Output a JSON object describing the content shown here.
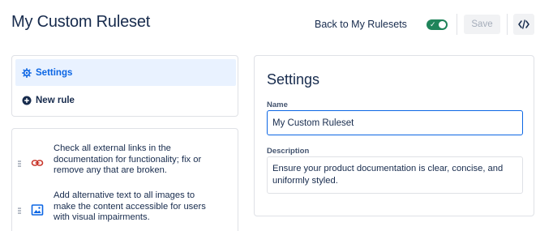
{
  "header": {
    "title": "My Custom Ruleset",
    "back_label": "Back to My Rulesets",
    "toggle_on": true,
    "save_label": "Save",
    "code_icon": "code-brackets-icon"
  },
  "nav": {
    "items": [
      {
        "label": "Settings",
        "icon": "gear-icon",
        "active": true
      },
      {
        "label": "New rule",
        "icon": "plus-circle-icon",
        "active": false
      }
    ]
  },
  "rules": [
    {
      "text": "Check all external links in the documentation for functionality; fix or remove any that are broken.",
      "icon": "link-icon"
    },
    {
      "text": "Add alternative text to all images to make the content accessible for users with visual impairments.",
      "icon": "image-icon"
    }
  ],
  "settings": {
    "title": "Settings",
    "name_label": "Name",
    "name_value": "My Custom Ruleset",
    "description_label": "Description",
    "description_value": "Ensure your product documentation is clear, concise, and uniformly styled."
  },
  "colors": {
    "accent": "#0c66e4",
    "toggle_on": "#1f845a",
    "link_icon": "#c9372c",
    "active_nav_bg": "#e9f2ff"
  }
}
